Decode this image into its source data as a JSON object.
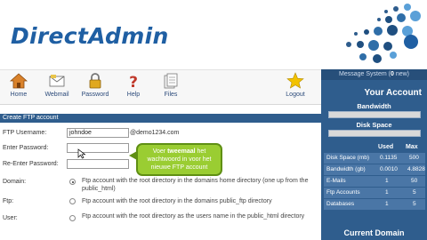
{
  "header": {
    "logo": "DirectAdmin"
  },
  "toolbar": [
    {
      "label": "Home",
      "icon": "house-icon"
    },
    {
      "label": "Webmail",
      "icon": "mail-icon"
    },
    {
      "label": "Password",
      "icon": "lock-icon"
    },
    {
      "label": "Help",
      "icon": "help-icon"
    },
    {
      "label": "Files",
      "icon": "files-icon"
    },
    {
      "label": "Logout",
      "icon": "star-icon"
    }
  ],
  "side": {
    "message_prefix": "Message System (",
    "message_count": "0",
    "message_suffix": " new)",
    "title": "Your Account",
    "bandwidth_label": "Bandwidth",
    "disk_label": "Disk Space",
    "col_used": "Used",
    "col_max": "Max",
    "stats": [
      {
        "name": "Disk Space (mb)",
        "used": "0.1135",
        "max": "500"
      },
      {
        "name": "Bandwidth (gb)",
        "used": "0.0010",
        "max": "4.8828"
      },
      {
        "name": "E-Mails",
        "used": "1",
        "max": "50"
      },
      {
        "name": "Ftp Accounts",
        "used": "1",
        "max": "5"
      },
      {
        "name": "Databases",
        "used": "1",
        "max": "5"
      }
    ],
    "current_domain": "Current Domain"
  },
  "form": {
    "section_title": "Create FTP account",
    "username_label": "FTP Username:",
    "username_value": "johndoe",
    "username_suffix": "@demo1234.com",
    "password_label": "Enter Password:",
    "repassword_label": "Re-Enter Password:",
    "domain_label": "Domain:",
    "domain_text": "Ftp account with the root directory in the domains home directory (one up from the public_html)",
    "ftp_label": "Ftp:",
    "ftp_text": "Ftp account with the root directory in the domains public_ftp directory",
    "user_label": "User:",
    "user_text": "Ftp account with the root directory as the users name in the public_html directory"
  },
  "tooltip": {
    "line1_pre": "Voer ",
    "line1_bold": "tweemaal",
    "line1_post": " het",
    "line2": "wachtwoord in voor het",
    "line3": "nieuwe FTP account"
  },
  "colors": {
    "brand": "#1f5fa3",
    "panel": "#2f5d8d",
    "tooltip": "#9acd32"
  }
}
